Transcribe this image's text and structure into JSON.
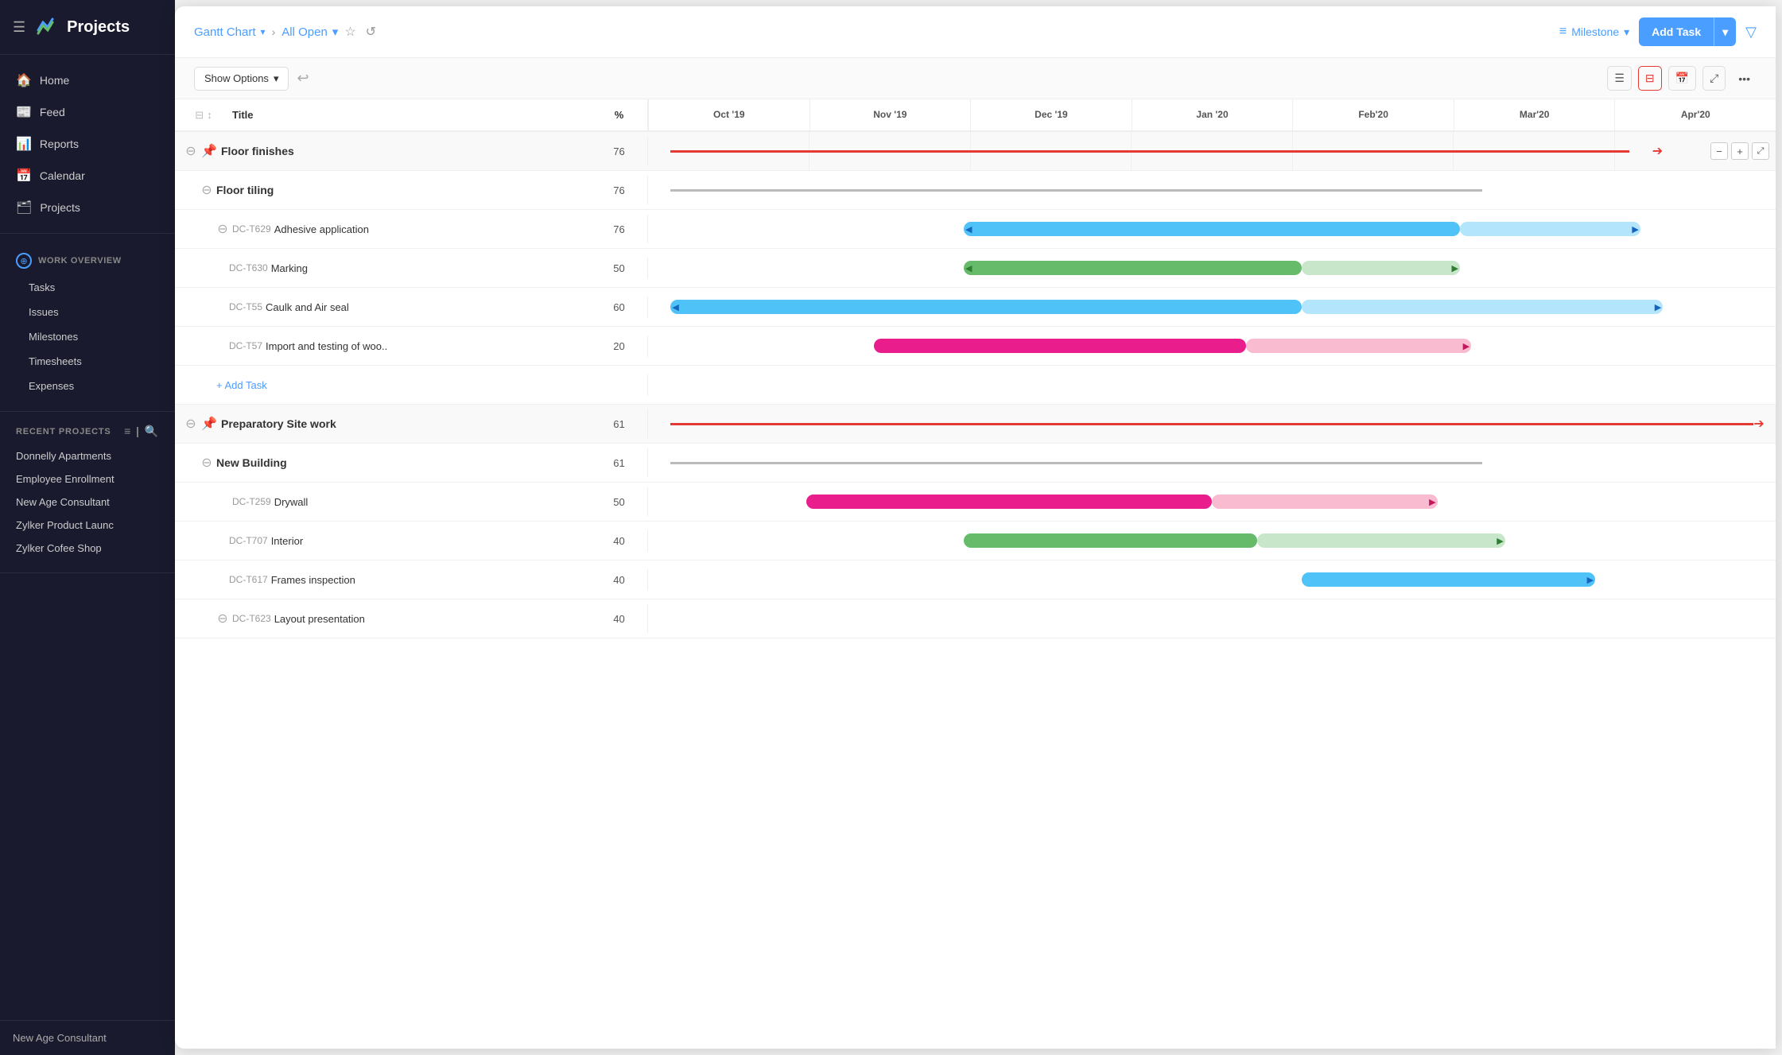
{
  "app": {
    "title": "Projects",
    "hamburger": "☰"
  },
  "sidebar": {
    "nav_items": [
      {
        "label": "Home",
        "icon": "🏠"
      },
      {
        "label": "Feed",
        "icon": "📰"
      },
      {
        "label": "Reports",
        "icon": "📊"
      },
      {
        "label": "Calendar",
        "icon": "📅"
      },
      {
        "label": "Projects",
        "icon": "🗂"
      }
    ],
    "work_overview_label": "WORK OVERVIEW",
    "work_items": [
      "Tasks",
      "Issues",
      "Milestones",
      "Timesheets",
      "Expenses"
    ],
    "recent_projects_label": "RECENT PROJECTS",
    "recent_projects": [
      "Donnelly Apartments",
      "Employee Enrollment",
      "New Age Consultant",
      "Zylker Product Launc",
      "Zylker Cofee Shop"
    ],
    "footer_text": "New Age Consultant"
  },
  "topbar": {
    "breadcrumb_main": "Gantt Chart",
    "breadcrumb_sub": "All Open",
    "milestone_label": "Milestone",
    "add_task_label": "Add Task",
    "filter_icon": "▼"
  },
  "toolbar": {
    "show_options_label": "Show Options",
    "undo_icon": "↩"
  },
  "gantt": {
    "header": {
      "title_col": "Title",
      "percent_col": "%",
      "months": [
        "Oct '19",
        "Nov '19",
        "Dec '19",
        "Jan '20",
        "Feb'20",
        "Mar'20",
        "Apr'20"
      ]
    },
    "rows": [
      {
        "id": "floor-finishes",
        "indent": 0,
        "type": "group",
        "expand": "⊖",
        "task_icon": "📌",
        "code": "",
        "name": "Floor finishes",
        "percent": "76",
        "bar_type": "red-line",
        "bar_left": "0%",
        "bar_width": "87%"
      },
      {
        "id": "floor-tiling",
        "indent": 1,
        "type": "subgroup",
        "expand": "⊖",
        "code": "",
        "name": "Floor tiling",
        "percent": "76",
        "bar_type": "gray-line",
        "bar_left": "0%",
        "bar_width": "73%"
      },
      {
        "id": "dc-t629",
        "indent": 2,
        "type": "task",
        "expand": "⊖",
        "code": "DC-T629",
        "name": "Adhesive application",
        "percent": "76",
        "bar_type": "blue",
        "bar_left": "28%",
        "bar_width": "45%"
      },
      {
        "id": "dc-t630",
        "indent": 3,
        "type": "task",
        "expand": "",
        "code": "DC-T630",
        "name": "Marking",
        "percent": "50",
        "bar_type": "green",
        "bar_left": "28%",
        "bar_width": "38%"
      },
      {
        "id": "dc-t55",
        "indent": 3,
        "type": "task",
        "expand": "",
        "code": "DC-T55",
        "name": "Caulk and Air seal",
        "percent": "60",
        "bar_type": "blue",
        "bar_left": "2%",
        "bar_width": "87%"
      },
      {
        "id": "dc-t57",
        "indent": 3,
        "type": "task",
        "expand": "",
        "code": "DC-T57",
        "name": "Import and testing of woo..",
        "percent": "20",
        "bar_type": "pink",
        "bar_left": "20%",
        "bar_width": "40%"
      },
      {
        "id": "add-task-1",
        "indent": 2,
        "type": "add",
        "name": "Add Task",
        "percent": ""
      },
      {
        "id": "prep-site",
        "indent": 0,
        "type": "group",
        "expand": "⊖",
        "task_icon": "📌",
        "code": "",
        "name": "Preparatory Site work",
        "percent": "61",
        "bar_type": "red-line",
        "bar_left": "0%",
        "bar_width": "100%"
      },
      {
        "id": "new-building",
        "indent": 1,
        "type": "subgroup",
        "expand": "⊖",
        "code": "",
        "name": "New Building",
        "percent": "61",
        "bar_type": "gray-line",
        "bar_left": "0%",
        "bar_width": "73%"
      },
      {
        "id": "dc-t259",
        "indent": 2,
        "type": "task",
        "expand": "",
        "code": "DC-T259",
        "name": "Drywall",
        "percent": "50",
        "bar_type": "pink",
        "bar_left": "14%",
        "bar_width": "40%"
      },
      {
        "id": "dc-t707",
        "indent": 3,
        "type": "task",
        "expand": "",
        "code": "DC-T707",
        "name": "Interior",
        "percent": "40",
        "bar_type": "green",
        "bar_left": "28%",
        "bar_width": "35%"
      },
      {
        "id": "dc-t617",
        "indent": 3,
        "type": "task",
        "expand": "",
        "code": "DC-T617",
        "name": "Frames inspection",
        "percent": "40",
        "bar_type": "blue",
        "bar_left": "60%",
        "bar_width": "30%"
      },
      {
        "id": "dc-t623",
        "indent": 2,
        "type": "task",
        "expand": "⊖",
        "code": "DC-T623",
        "name": "Layout presentation",
        "percent": "40",
        "bar_type": "none"
      }
    ]
  },
  "colors": {
    "brand_blue": "#4a9eff",
    "sidebar_bg": "#1a1a2e",
    "red": "#e53935",
    "pink": "#e91e8c",
    "green": "#66bb6a",
    "blue_bar": "#4fc3f7"
  }
}
